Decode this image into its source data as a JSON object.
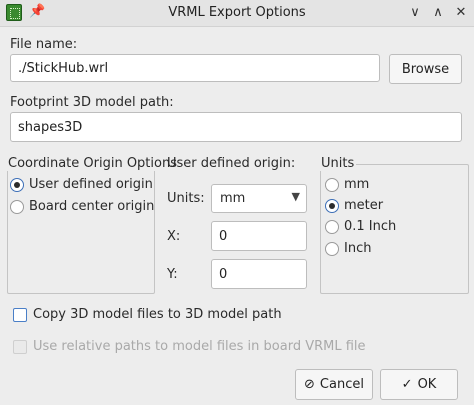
{
  "window": {
    "title": "VRML Export Options",
    "minimize_glyph": "∨",
    "maximize_glyph": "∧",
    "close_glyph": "✕",
    "pin_glyph": "📌"
  },
  "file_name": {
    "label": "File name:",
    "value": "./StickHub.wrl",
    "browse_label": "Browse"
  },
  "footprint_path": {
    "label": "Footprint 3D model path:",
    "value": "shapes3D"
  },
  "coordinate_origin": {
    "title": "Coordinate Origin Options",
    "options": [
      {
        "label": "User defined origin",
        "selected": true
      },
      {
        "label": "Board center origin",
        "selected": false
      }
    ]
  },
  "user_origin": {
    "title": "User defined origin:",
    "units_label": "Units:",
    "units_value": "mm",
    "x_label": "X:",
    "x_value": "0",
    "y_label": "Y:",
    "y_value": "0"
  },
  "units": {
    "title": "Units",
    "options": [
      {
        "label": "mm",
        "selected": false
      },
      {
        "label": "meter",
        "selected": true
      },
      {
        "label": "0.1 Inch",
        "selected": false
      },
      {
        "label": "Inch",
        "selected": false
      }
    ]
  },
  "options": {
    "copy_models_label": "Copy 3D model files to 3D model path",
    "copy_models_checked": false,
    "relative_paths_label": "Use relative paths to model files in board VRML file",
    "relative_paths_enabled": false
  },
  "buttons": {
    "cancel_label": "Cancel",
    "cancel_icon": "⊘",
    "ok_label": "OK",
    "ok_icon": "✓"
  }
}
